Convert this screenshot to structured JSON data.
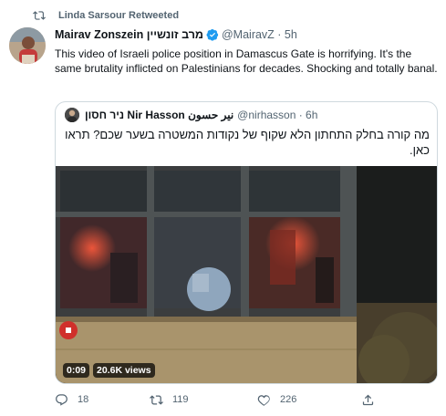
{
  "retweet": {
    "icon": "retweet-icon",
    "label": "Linda Sarsour Retweeted"
  },
  "tweet": {
    "author_name": "Mairav Zonszein מרב זונשיין",
    "verified_icon": "verified-badge-icon",
    "handle": "@MairavZ · 5h",
    "text": "This video of Israeli police position in Damascus Gate is horrifying. It's the same brutality inflicted on Palestinians for decades. Shocking and totally banal."
  },
  "quoted_tweet": {
    "author_name": "ניר חסון Nir Hasson نير حسون",
    "handle": "@nirhasson · 6h",
    "text": "מה קורה בחלק התחתון הלא שקוף של נקודות המשטרה בשער שכם? תראו כאן.",
    "video": {
      "time": "0:09",
      "views": "20.6K views"
    }
  },
  "actions": {
    "reply_count": "18",
    "retweet_count": "119",
    "like_count": "226"
  },
  "colors": {
    "accent": "#1d9bf0",
    "muted": "#536471",
    "border": "#cfd9de"
  }
}
